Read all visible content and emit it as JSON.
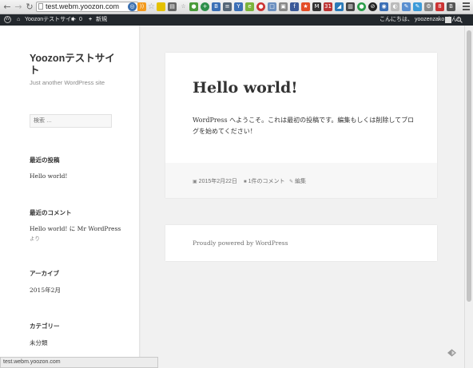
{
  "browser": {
    "url": "test.webm.yoozon.com",
    "nav_icons": [
      "back-arrow-icon",
      "forward-arrow-icon",
      "reload-icon"
    ],
    "extension_icons": [
      "rss-icon",
      "star-icon"
    ],
    "status_url": "test.webm.yoozon.com"
  },
  "adminbar": {
    "site_name": "Yoozonテストサイト",
    "comments_count": "0",
    "new_label": "新規",
    "greeting": "こんにちは、 yoozenzako さん！"
  },
  "site": {
    "title": "Yoozonテストサイト",
    "description": "Just another WordPress site"
  },
  "sidebar": {
    "search_placeholder": "検索 …",
    "recent_posts_title": "最近の投稿",
    "recent_post": "Hello world!",
    "recent_comments_title": "最近のコメント",
    "recent_comment_line1": "Hello world! に Mr WordPress",
    "recent_comment_line2": "より",
    "archives_title": "アーカイブ",
    "archive_item": "2015年2月",
    "categories_title": "カテゴリー",
    "category_item": "未分類"
  },
  "post": {
    "title": "Hello world!",
    "body": "WordPress へようこそ。これは最初の投稿です。編集もしくは削除してブログを始めてください！",
    "date": "2015年2月22日",
    "comments": "1件のコメント",
    "edit": "編集"
  },
  "footer": {
    "text": "Proudly powered by WordPress"
  },
  "colors": {
    "adminbar": "#23282d",
    "background": "#f1f1f1",
    "text": "#333333"
  }
}
